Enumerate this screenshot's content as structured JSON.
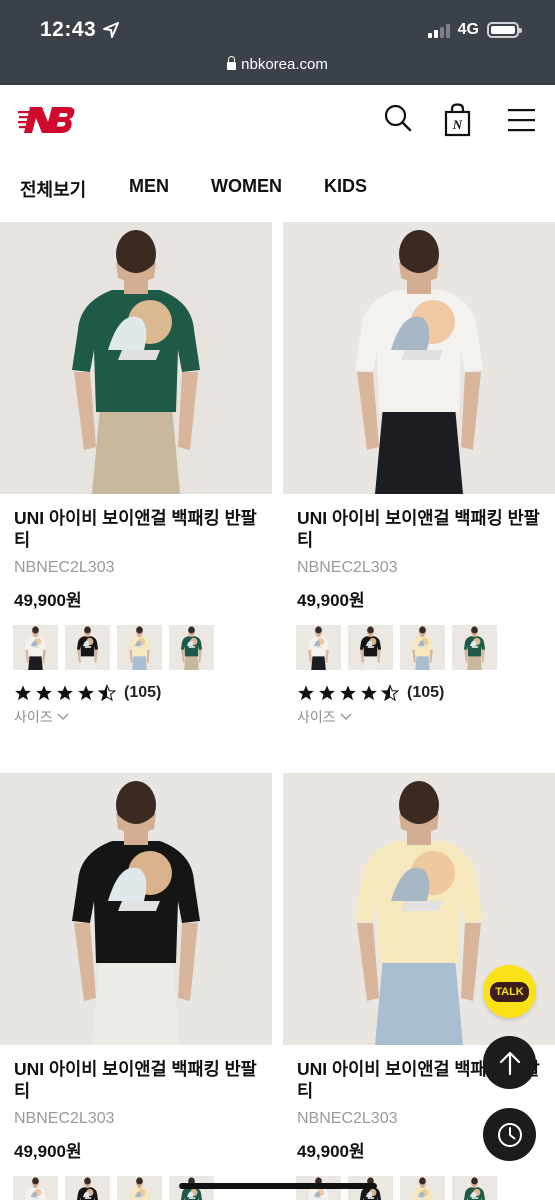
{
  "status_bar": {
    "time": "12:43",
    "network": "4G",
    "url": "nbkorea.com"
  },
  "header": {
    "logo": "new-balance-logo",
    "icons": [
      "search-icon",
      "shopping-bag-icon",
      "hamburger-menu-icon"
    ]
  },
  "categories": [
    "전체보기",
    "MEN",
    "WOMEN",
    "KIDS"
  ],
  "colors": {
    "status_bar": "#3b4148",
    "brand_red": "#cf0a2c",
    "fab": "#1c1c1c",
    "talk": "#fbe216"
  },
  "products": [
    {
      "name": "UNI 아이비 보이앤걸 백패킹 반팔티",
      "code": "NBNEC2L303",
      "price": "49,900원",
      "rating": 4.5,
      "reviews": "(105)",
      "size_label": "사이즈",
      "shirt_color": "#1f5a48",
      "pants_color": "#c9b99c",
      "bg": "#e7e4e0"
    },
    {
      "name": "UNI 아이비 보이앤걸 백패킹 반팔티",
      "code": "NBNEC2L303",
      "price": "49,900원",
      "rating": 4.5,
      "reviews": "(105)",
      "size_label": "사이즈",
      "shirt_color": "#f3f2ee",
      "pants_color": "#1c1d22",
      "bg": "#e9e6e1"
    },
    {
      "name": "UNI 아이비 보이앤걸 백패킹 반팔티",
      "code": "NBNEC2L303",
      "price": "49,900원",
      "shirt_color": "#151515",
      "pants_color": "#ecebe6",
      "bg": "#e8e6e2"
    },
    {
      "name": "UNI 아이비 보이앤걸 백패킹 반팔티",
      "code": "NBNEC2L303",
      "price": "49,900원",
      "shirt_color": "#f5e8bc",
      "pants_color": "#a9bfd1",
      "bg": "#e9e6e1"
    }
  ],
  "swatch_colors": [
    "#f3f2ee",
    "#151515",
    "#f5e8bc",
    "#1f5a48"
  ],
  "floating": {
    "talk_label": "TALK"
  }
}
